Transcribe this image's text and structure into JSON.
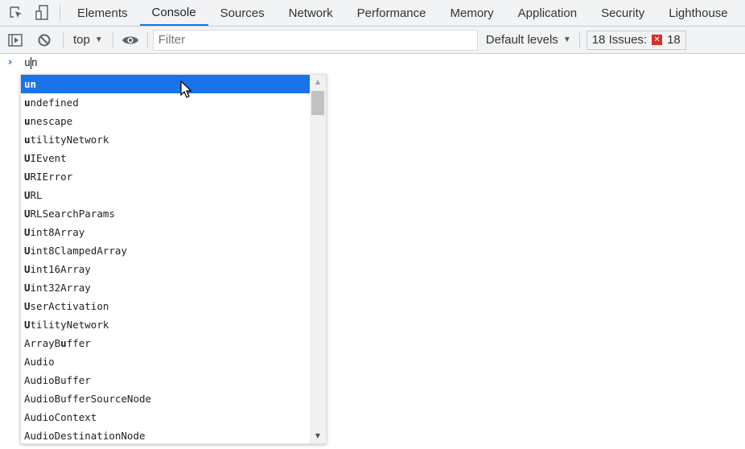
{
  "tabs": [
    {
      "label": "Elements"
    },
    {
      "label": "Console",
      "active": true
    },
    {
      "label": "Sources"
    },
    {
      "label": "Network"
    },
    {
      "label": "Performance"
    },
    {
      "label": "Memory"
    },
    {
      "label": "Application"
    },
    {
      "label": "Security"
    },
    {
      "label": "Lighthouse"
    }
  ],
  "toolbar": {
    "context": "top",
    "filter_placeholder": "Filter",
    "levels": "Default levels",
    "issues_label": "18 Issues:",
    "issues_count": "18"
  },
  "console": {
    "input_before": "u",
    "input_after": "n"
  },
  "autocomplete": [
    {
      "m": "un",
      "r": "",
      "selected": true
    },
    {
      "m": "u",
      "r": "ndefined"
    },
    {
      "m": "u",
      "r": "nescape"
    },
    {
      "m": "u",
      "r": "tilityNetwork"
    },
    {
      "m": "U",
      "r": "IEvent"
    },
    {
      "m": "U",
      "r": "RIError"
    },
    {
      "m": "U",
      "r": "RL"
    },
    {
      "m": "U",
      "r": "RLSearchParams"
    },
    {
      "m": "U",
      "r": "int8Array"
    },
    {
      "m": "U",
      "r": "int8ClampedArray"
    },
    {
      "m": "U",
      "r": "int16Array"
    },
    {
      "m": "U",
      "r": "int32Array"
    },
    {
      "m": "U",
      "r": "serActivation"
    },
    {
      "m": "U",
      "r": "tilityNetwork"
    },
    {
      "l": "ArrayB",
      "m": "u",
      "r": "ffer"
    },
    {
      "l": "Audio",
      "m": "",
      "r": ""
    },
    {
      "l": "AudioBuffer",
      "m": "",
      "r": ""
    },
    {
      "l": "AudioBufferSourceNode",
      "m": "",
      "r": ""
    },
    {
      "l": "AudioContext",
      "m": "",
      "r": ""
    },
    {
      "l": "AudioDestinationNode",
      "m": "",
      "r": ""
    }
  ],
  "colors": {
    "accent": "#1a73e8",
    "error": "#d93025"
  }
}
